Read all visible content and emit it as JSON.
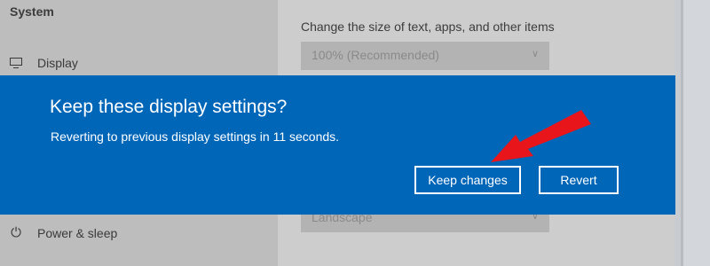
{
  "settings": {
    "sidebar": {
      "heading": "System",
      "items": [
        {
          "label": "Display",
          "icon": "monitor-icon"
        },
        {
          "label": "Power & sleep",
          "icon": "power-icon"
        }
      ]
    },
    "main": {
      "scale_label": "Change the size of text, apps, and other items",
      "scale_value": "100% (Recommended)",
      "orientation_value": "Landscape"
    }
  },
  "dialog": {
    "title": "Keep these display settings?",
    "message": "Reverting to previous display settings in 11 seconds.",
    "keep_label": "Keep changes",
    "revert_label": "Revert",
    "background_color": "#0066b8"
  },
  "annotation": {
    "color": "#e8151b",
    "icon": "red-arrow-icon"
  }
}
